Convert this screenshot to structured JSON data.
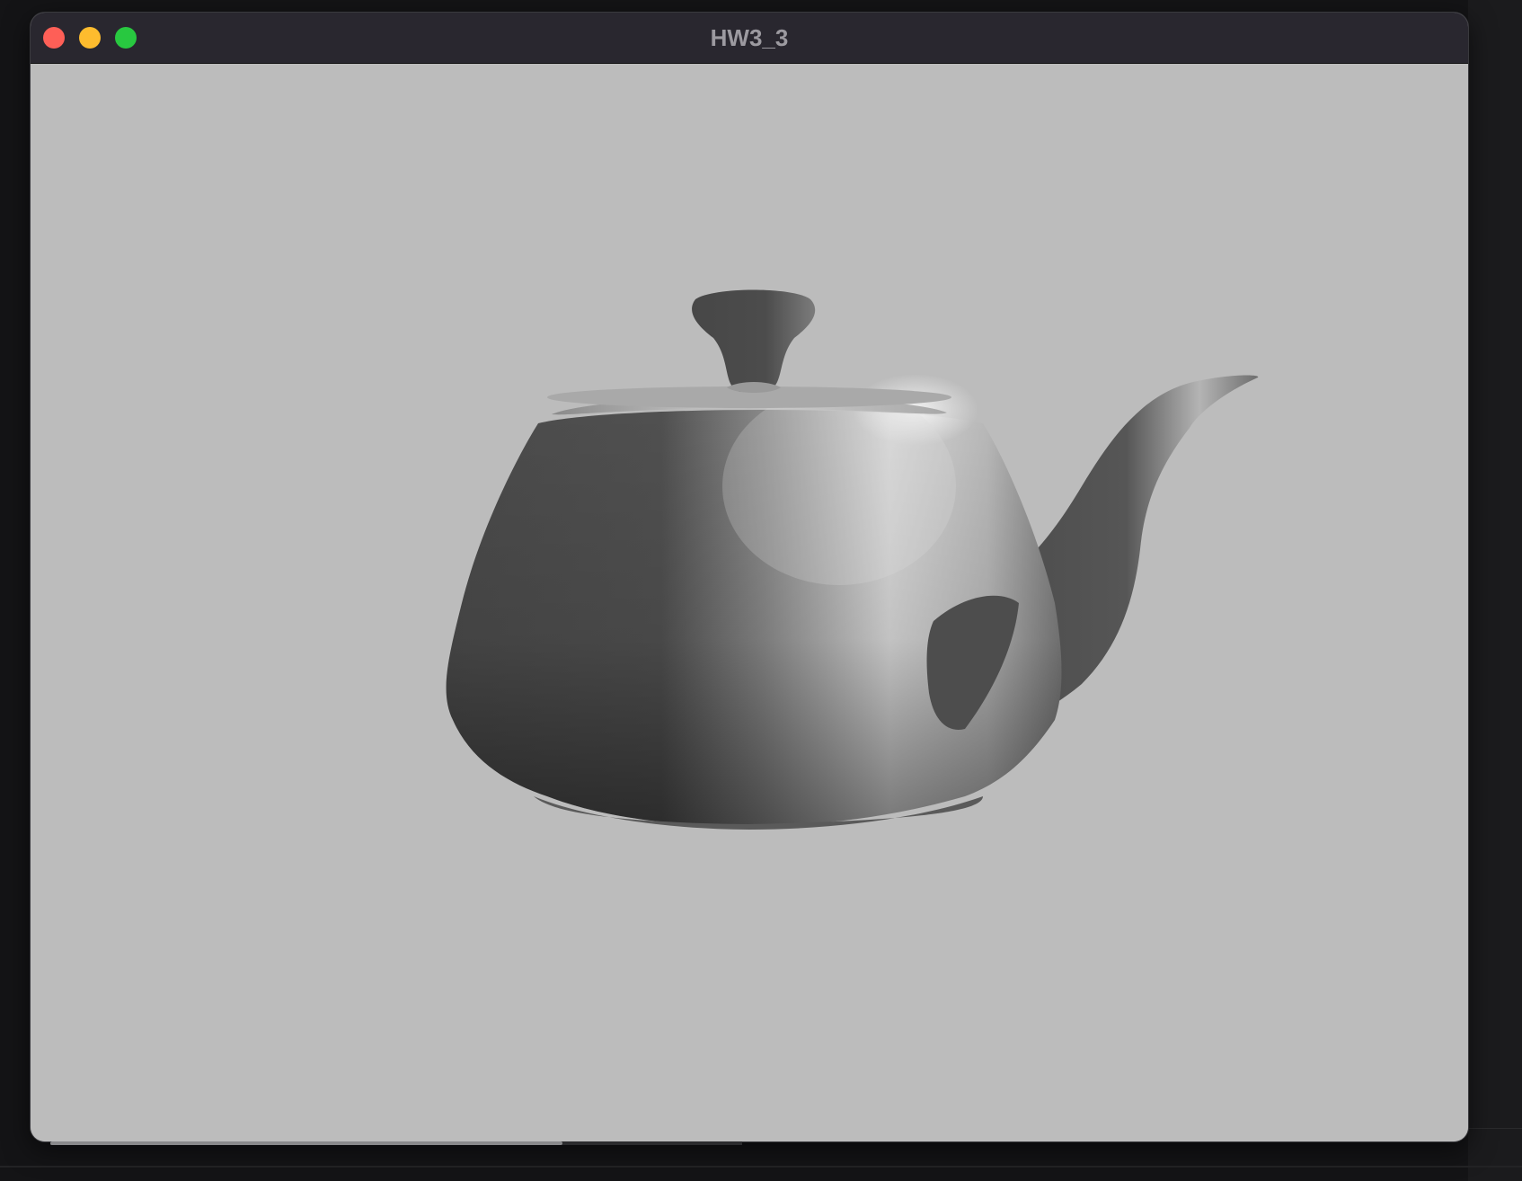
{
  "window": {
    "title": "HW3_3",
    "controls": {
      "close": "close-button",
      "minimize": "minimize-button",
      "zoom": "zoom-button"
    }
  },
  "viewport": {
    "background_color": "#bcbcbc",
    "object": "teapot"
  },
  "colors": {
    "titlebar": "#29272f",
    "close": "#fe5f57",
    "minimize": "#febc2e",
    "zoom": "#28c840"
  }
}
